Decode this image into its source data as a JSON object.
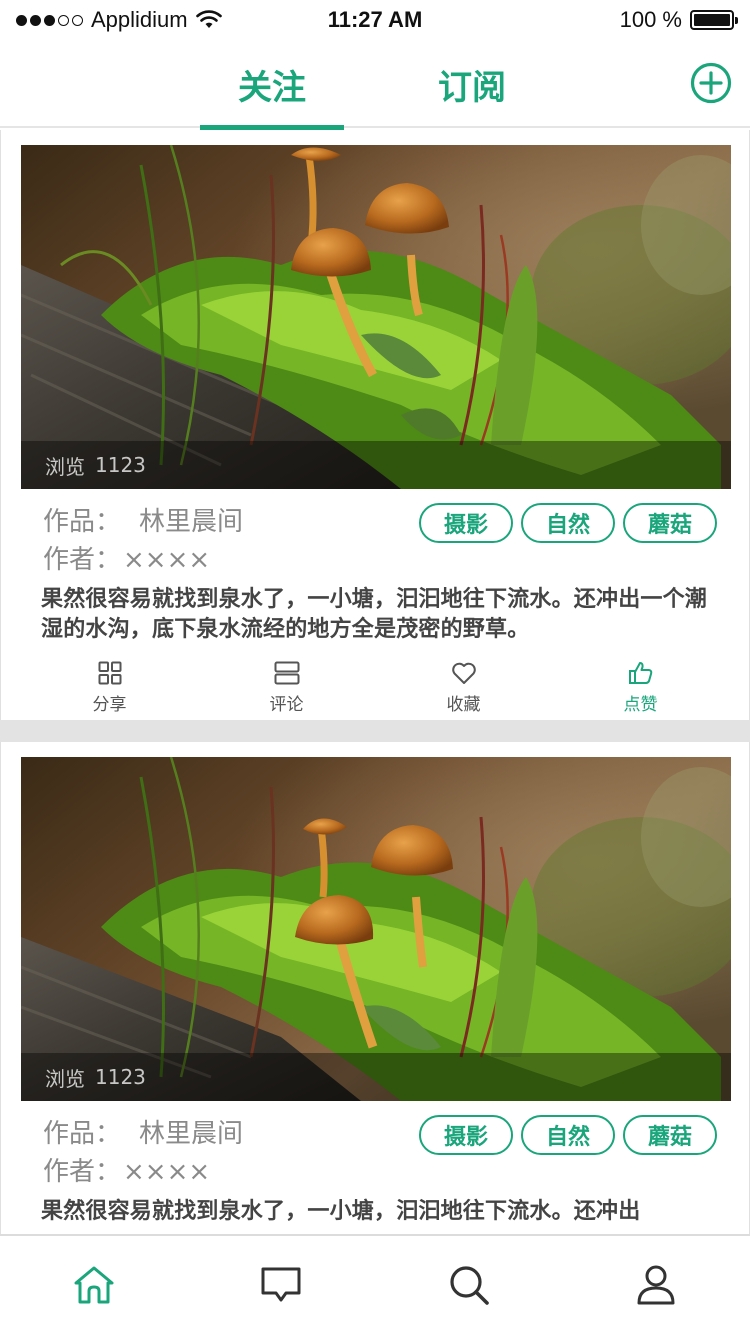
{
  "status_bar": {
    "carrier": "Applidium",
    "time": "11:27 AM",
    "battery_text": "100 %",
    "battery_level": 100
  },
  "top_nav": {
    "tabs": [
      {
        "label": "关注",
        "active": true
      },
      {
        "label": "订阅",
        "active": false
      }
    ],
    "add_icon": "plus-circle-icon"
  },
  "feed": {
    "cards": [
      {
        "views_label": "浏览",
        "views_count": "1123",
        "work_label": "作品：",
        "work_title": "林里晨间",
        "author_label": "作者：",
        "author_name": "××××",
        "tags": [
          "摄影",
          "自然",
          "蘑菇"
        ],
        "description": "果然很容易就找到泉水了，一小塘，汩汩地往下流水。还冲出一个潮湿的水沟，底下泉水流经的地方全是茂密的野草。",
        "actions": [
          {
            "label": "分享",
            "icon": "grid-icon"
          },
          {
            "label": "评论",
            "icon": "comment-icon"
          },
          {
            "label": "收藏",
            "icon": "heart-icon"
          },
          {
            "label": "点赞",
            "icon": "thumbs-up-icon",
            "active": true
          }
        ]
      },
      {
        "views_label": "浏览",
        "views_count": "1123",
        "work_label": "作品：",
        "work_title": "林里晨间",
        "author_label": "作者：",
        "author_name": "××××",
        "tags": [
          "摄影",
          "自然",
          "蘑菇"
        ],
        "description": "果然很容易就找到泉水了，一小塘，汩汩地往下流水。还冲出"
      }
    ]
  },
  "bottom_bar": {
    "items": [
      "home-icon",
      "message-icon",
      "search-icon",
      "user-icon"
    ],
    "accent": "#1aa57b"
  },
  "colors": {
    "accent": "#1aa57b",
    "text": "#444444",
    "muted": "#8a8a8a"
  }
}
